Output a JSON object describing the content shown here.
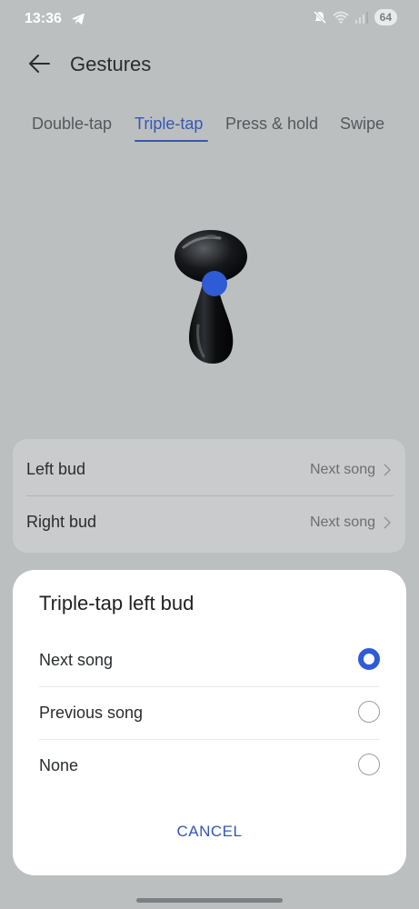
{
  "status_bar": {
    "time": "13:36",
    "battery": "64",
    "icons": [
      "telegram-icon",
      "mute-icon",
      "wifi-icon",
      "signal-icon"
    ]
  },
  "header": {
    "title": "Gestures",
    "back_icon": "arrow-left-icon"
  },
  "tabs": [
    {
      "label": "Double-tap",
      "active": false
    },
    {
      "label": "Triple-tap",
      "active": true
    },
    {
      "label": "Press & hold",
      "active": false
    },
    {
      "label": "Swipe",
      "active": false
    }
  ],
  "settings": [
    {
      "label": "Left bud",
      "value": "Next song"
    },
    {
      "label": "Right bud",
      "value": "Next song"
    }
  ],
  "dialog": {
    "title": "Triple-tap left bud",
    "options": [
      {
        "label": "Next song",
        "selected": true
      },
      {
        "label": "Previous song",
        "selected": false
      },
      {
        "label": "None",
        "selected": false
      }
    ],
    "cancel_label": "CANCEL"
  },
  "colors": {
    "accent": "#3656b4",
    "radio_selected": "#2f5bd6",
    "dimmed_background": "#bcbfc0",
    "dialog_background": "#ffffff"
  }
}
